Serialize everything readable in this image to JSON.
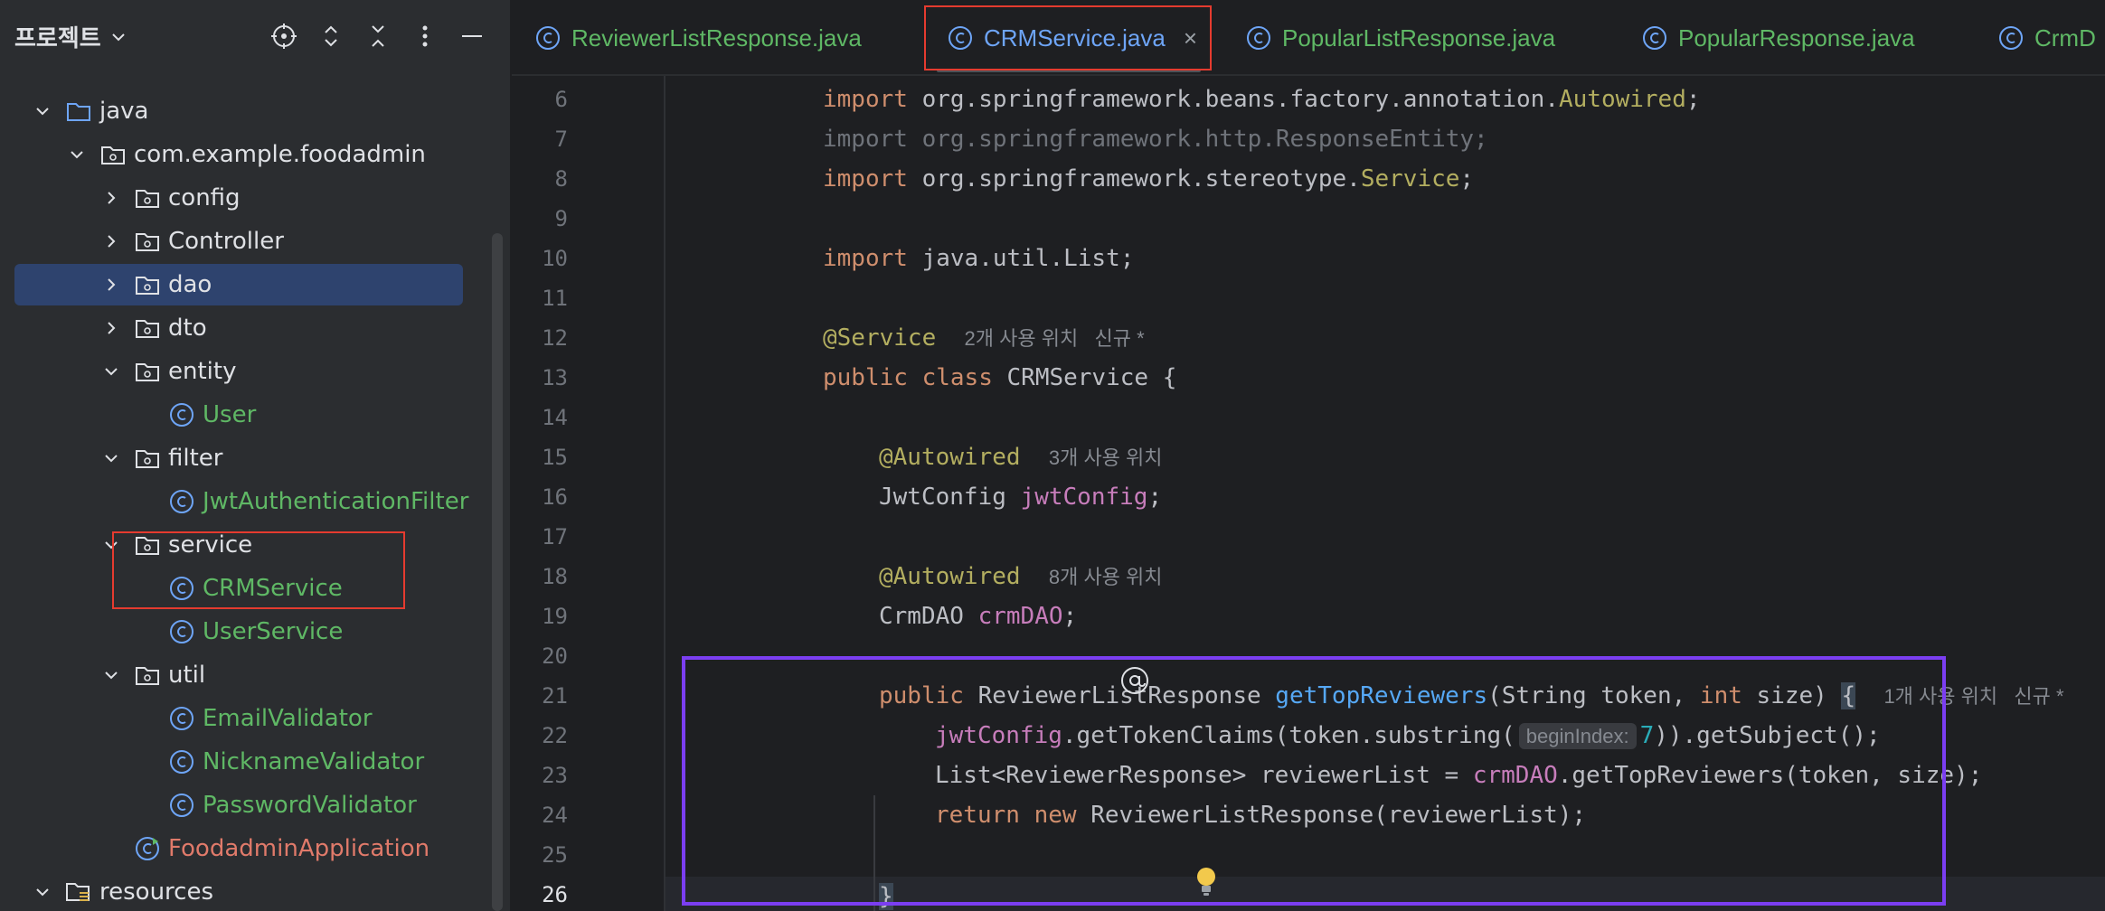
{
  "project_panel": {
    "title": "프로젝트",
    "tree": [
      {
        "label": "java",
        "kind": "folder-blue",
        "expanded": true
      },
      {
        "label": "com.example.foodadmin",
        "kind": "package",
        "expanded": true
      },
      {
        "label": "config",
        "kind": "package",
        "expanded": false
      },
      {
        "label": "Controller",
        "kind": "package",
        "expanded": false
      },
      {
        "label": "dao",
        "kind": "package",
        "expanded": false,
        "selected": true
      },
      {
        "label": "dto",
        "kind": "package",
        "expanded": false
      },
      {
        "label": "entity",
        "kind": "package",
        "expanded": true
      },
      {
        "label": "User",
        "kind": "class"
      },
      {
        "label": "filter",
        "kind": "package",
        "expanded": true
      },
      {
        "label": "JwtAuthenticationFilter",
        "kind": "class"
      },
      {
        "label": "service",
        "kind": "package",
        "expanded": true
      },
      {
        "label": "CRMService",
        "kind": "class"
      },
      {
        "label": "UserService",
        "kind": "class"
      },
      {
        "label": "util",
        "kind": "package",
        "expanded": true
      },
      {
        "label": "EmailValidator",
        "kind": "class"
      },
      {
        "label": "NicknameValidator",
        "kind": "class"
      },
      {
        "label": "PasswordValidator",
        "kind": "class"
      },
      {
        "label": "FoodadminApplication",
        "kind": "app-class"
      },
      {
        "label": "resources",
        "kind": "resources-folder",
        "expanded": true
      }
    ]
  },
  "tabs": [
    {
      "label": "ReviewerListResponse.java",
      "active": false
    },
    {
      "label": "CRMService.java",
      "active": true
    },
    {
      "label": "PopularListResponse.java",
      "active": false
    },
    {
      "label": "PopularResponse.java",
      "active": false
    },
    {
      "label": "CrmD",
      "active": false
    }
  ],
  "editor": {
    "line_numbers": [
      "6",
      "7",
      "8",
      "9",
      "10",
      "11",
      "12",
      "13",
      "14",
      "15",
      "16",
      "17",
      "18",
      "19",
      "20",
      "21",
      "22",
      "23",
      "24",
      "25",
      "26"
    ],
    "current_line": "26",
    "code": {
      "l6": {
        "kw": "import",
        "path": " org.springframework.beans.factory.annotation.",
        "cls": "Autowired",
        "end": ";"
      },
      "l7": {
        "text": "import org.springframework.http.ResponseEntity;"
      },
      "l8": {
        "kw": "import",
        "path": " org.springframework.stereotype.",
        "cls": "Service",
        "end": ";"
      },
      "l10": {
        "kw": "import",
        "path": " java.util.List;"
      },
      "l12": {
        "ann": "@Service",
        "hint": "2개 사용 위치   신규 *"
      },
      "l13": {
        "kw1": "public",
        "kw2": "class",
        "rest": " CRMService {"
      },
      "l15": {
        "ann": "@Autowired",
        "hint": "3개 사용 위치"
      },
      "l16": {
        "type": "JwtConfig ",
        "field": "jwtConfig",
        "end": ";"
      },
      "l18": {
        "ann": "@Autowired",
        "hint": "8개 사용 위치"
      },
      "l19": {
        "type": "CrmDAO ",
        "field": "crmDAO",
        "end": ";"
      },
      "l21": {
        "kw": "public",
        "type": " ReviewerListResponse ",
        "method": "getTopReviewers",
        "params1": "(String token, ",
        "kw2": "int",
        "params2": " size) ",
        "brace": "{",
        "hint": "1개 사용 위치   신규 *"
      },
      "l22": {
        "field": "jwtConfig",
        "mid": ".getTokenClaims(token.substring(",
        "inlay": "beginIndex:",
        "num": "7",
        "end": ")).getSubject();"
      },
      "l23": {
        "pre": "List<ReviewerResponse> reviewerList = ",
        "field": "crmDAO",
        "end": ".getTopReviewers(token, size);"
      },
      "l24": {
        "kw1": "return",
        "kw2": "new",
        "rest": " ReviewerListResponse(reviewerList);"
      },
      "l26": {
        "brace": "}"
      }
    }
  },
  "colors": {
    "accent_red": "#e53b2f",
    "accent_purple": "#7b3ef2",
    "selection": "#2e436e"
  }
}
